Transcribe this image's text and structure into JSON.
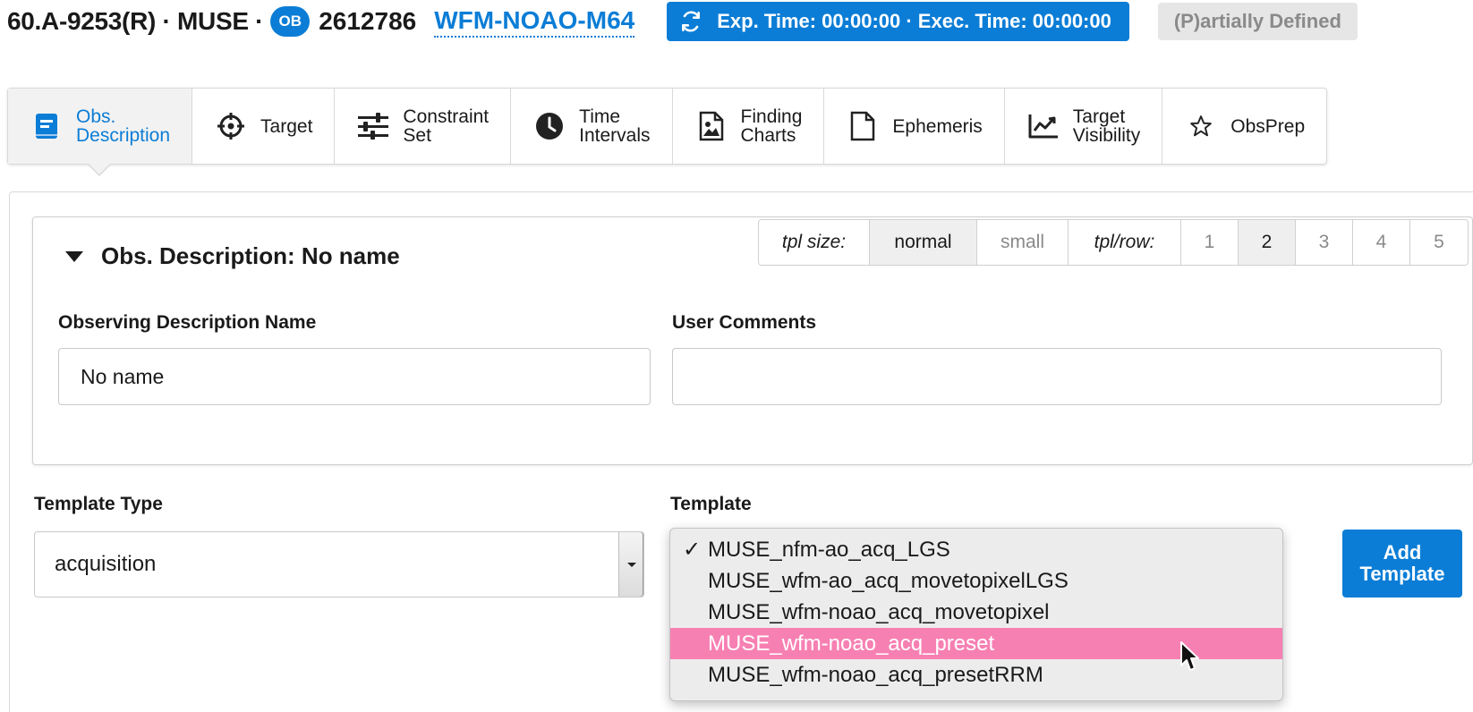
{
  "header": {
    "prefix": "60.A-9253(R) · MUSE ·",
    "ob_badge": "OB",
    "ob_number": "2612786",
    "ob_name": "WFM-NOAO-M64",
    "exec_time": "Exp. Time: 00:00:00 · Exec. Time: 00:00:00",
    "status": "(P)artially Defined"
  },
  "tabs": [
    {
      "label": "Obs.\nDescription",
      "icon": "book-icon",
      "active": true
    },
    {
      "label": "Target",
      "icon": "crosshair-icon"
    },
    {
      "label": "Constraint\nSet",
      "icon": "sliders-icon"
    },
    {
      "label": "Time\nIntervals",
      "icon": "clock-icon"
    },
    {
      "label": "Finding\nCharts",
      "icon": "image-file-icon"
    },
    {
      "label": "Ephemeris",
      "icon": "file-icon"
    },
    {
      "label": "Target\nVisibility",
      "icon": "line-chart-icon"
    },
    {
      "label": "ObsPrep",
      "icon": "star-icon"
    }
  ],
  "obs_description": {
    "title": "Obs. Description: No name",
    "tpl_size_label": "tpl size:",
    "tpl_size_options": [
      "normal",
      "small"
    ],
    "tpl_size_selected": "normal",
    "tpl_row_label": "tpl/row:",
    "tpl_row_options": [
      "1",
      "2",
      "3",
      "4",
      "5"
    ],
    "tpl_row_selected": "2",
    "name_label": "Observing Description Name",
    "name_value": "No name",
    "comments_label": "User Comments",
    "comments_value": ""
  },
  "template_section": {
    "type_label": "Template Type",
    "type_value": "acquisition",
    "template_label": "Template",
    "options": [
      "MUSE_nfm-ao_acq_LGS",
      "MUSE_wfm-ao_acq_movetopixelLGS",
      "MUSE_wfm-noao_acq_movetopixel",
      "MUSE_wfm-noao_acq_preset",
      "MUSE_wfm-noao_acq_presetRRM"
    ],
    "checked_index": 0,
    "highlight_index": 3,
    "check_mark": "✓",
    "add_button": "Add\nTemplate"
  },
  "colors": {
    "accent": "#0b7dd6",
    "highlight": "#f780b3",
    "status_bg": "#e6e6e6"
  }
}
